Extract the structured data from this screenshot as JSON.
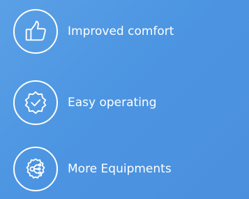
{
  "features": [
    {
      "label": "Improved comfort",
      "icon": "thumbs-up-icon"
    },
    {
      "label": "Easy operating",
      "icon": "badge-check-icon"
    },
    {
      "label": "More Equipments",
      "icon": "circuit-network-icon"
    }
  ],
  "colors": {
    "background": "#4c95e2",
    "foreground": "#ffffff"
  }
}
